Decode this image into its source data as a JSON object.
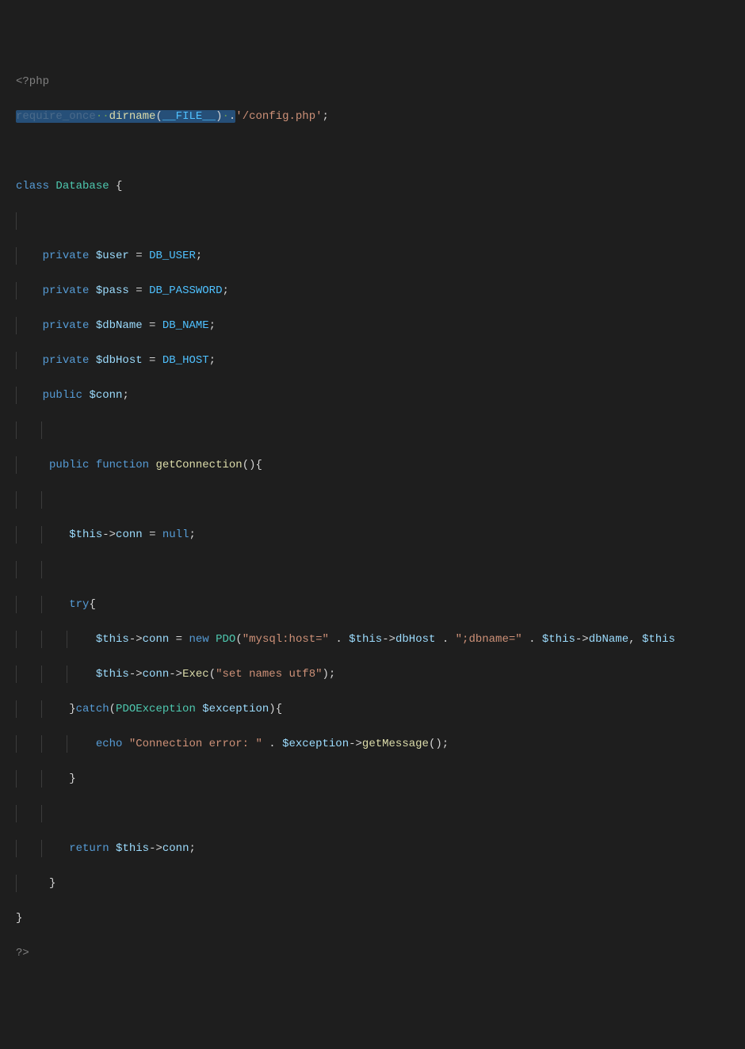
{
  "code": {
    "open_tag": "<?php",
    "require": "require_once",
    "dirname": "dirname",
    "file_const": "__FILE__",
    "config_str": "'/config.php'",
    "class_kw": "class",
    "class_name": "Database",
    "private_kw": "private",
    "public_kw": "public",
    "function_kw": "function",
    "method_name": "getConnection",
    "var_user": "$user",
    "var_pass": "$pass",
    "var_dbname": "$dbName",
    "var_dbhost": "$dbHost",
    "var_conn": "$conn",
    "var_this": "$this",
    "var_exception": "$exception",
    "const_user": "DB_USER",
    "const_pass": "DB_PASSWORD",
    "const_name": "DB_NAME",
    "const_host": "DB_HOST",
    "null_kw": "null",
    "try_kw": "try",
    "catch_kw": "catch",
    "new_kw": "new",
    "pdo": "PDO",
    "pdo_ex": "PDOException",
    "echo_kw": "echo",
    "return_kw": "return",
    "str_mysql": "\"mysql:host=\"",
    "str_dbname": "\";dbname=\"",
    "str_utf8": "\"set names utf8\"",
    "str_conn_err": "\"Connection error: \"",
    "prop_conn": "conn",
    "prop_dbhost": "dbHost",
    "prop_dbname": "dbName",
    "method_exec": "Exec",
    "method_getmsg": "getMessage",
    "close_tag": "?>",
    "dots2": "··",
    "dots1": "·"
  }
}
